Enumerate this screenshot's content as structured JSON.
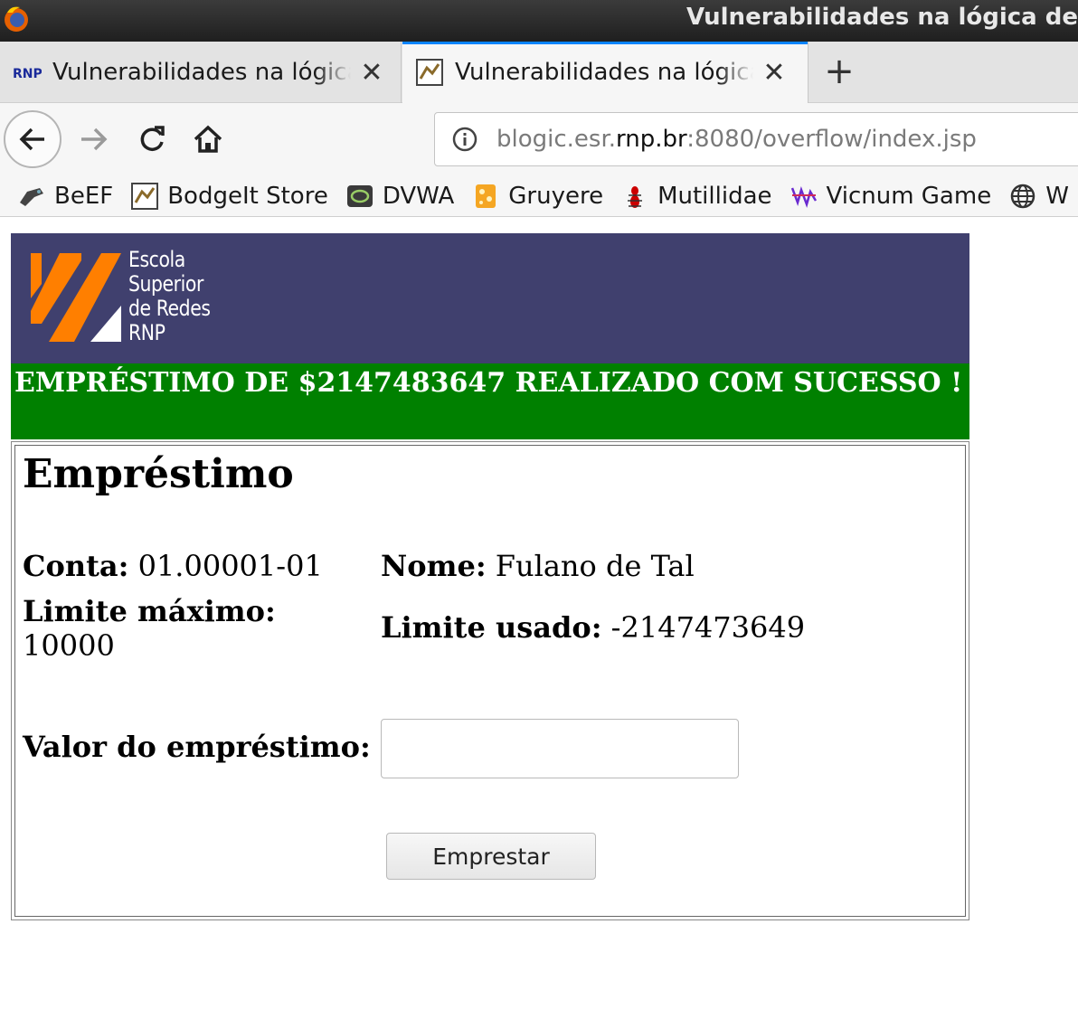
{
  "window": {
    "title": "Vulnerabilidades na lógica de"
  },
  "tabs": [
    {
      "label": "Vulnerabilidades na lógica de negócio",
      "favicon": "rnp-icon",
      "active": false
    },
    {
      "label": "Vulnerabilidades na lógica de negócio",
      "favicon": "bodgeit-icon",
      "active": true
    }
  ],
  "toolbar": {
    "url_prefix": "blogic.esr.",
    "url_host": "rnp.br",
    "url_suffix": ":8080/overflow/index.jsp"
  },
  "bookmarks": [
    {
      "label": "BeEF",
      "icon": "beef-icon"
    },
    {
      "label": "BodgeIt Store",
      "icon": "bodgeit-icon"
    },
    {
      "label": "DVWA",
      "icon": "dvwa-icon"
    },
    {
      "label": "Gruyere",
      "icon": "gruyere-icon"
    },
    {
      "label": "Mutillidae",
      "icon": "mutillidae-icon"
    },
    {
      "label": "Vicnum Game",
      "icon": "vicnum-icon"
    },
    {
      "label": "W",
      "icon": "globe-icon"
    }
  ],
  "logo": {
    "line1": "Escola",
    "line2": "Superior",
    "line3": "de Redes",
    "line4": "RNP"
  },
  "message": {
    "success": "EMPRÉSTIMO DE $2147483647 REALIZADO COM SUCESSO !"
  },
  "loan": {
    "title": "Empréstimo",
    "conta_label": "Conta:",
    "conta_value": "01.00001-01",
    "nome_label": "Nome:",
    "nome_value": "Fulano de Tal",
    "limite_max_label": "Limite máximo:",
    "limite_max_value": "10000",
    "limite_usado_label": "Limite usado:",
    "limite_usado_value": "-2147473649",
    "valor_label": "Valor do empréstimo:",
    "valor_value": "",
    "submit_label": "Emprestar"
  },
  "colors": {
    "banner": "#40406e",
    "success": "#008000",
    "logo_orange": "#ff7f00"
  }
}
